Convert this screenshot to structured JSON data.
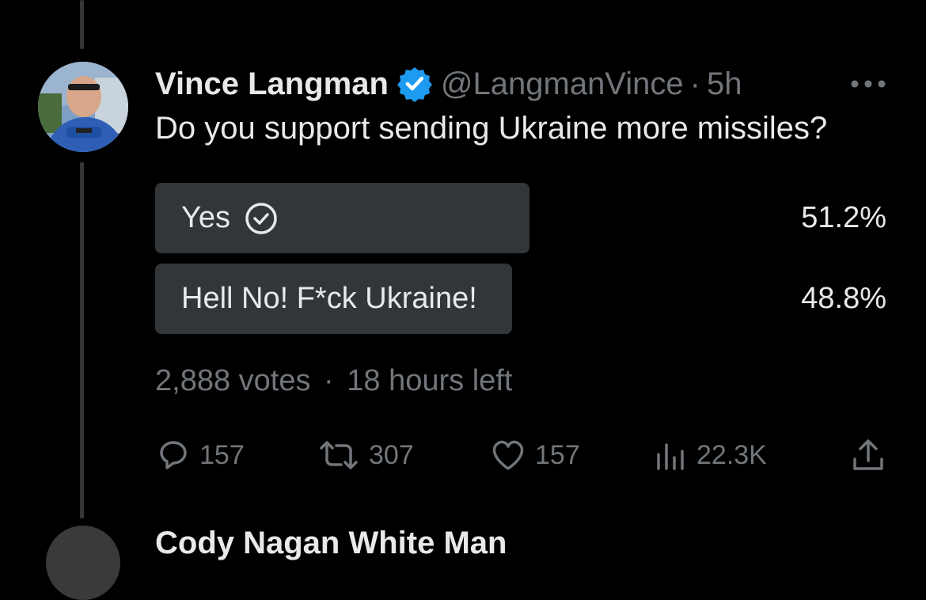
{
  "tweet": {
    "author_name": "Vince Langman",
    "handle": "@LangmanVince",
    "separator": "·",
    "time": "5h",
    "text": "Do you support sending Ukraine more missiles?",
    "verified_icon": "verified-badge-icon",
    "more_icon": "more-options-icon"
  },
  "poll": {
    "options": [
      {
        "label": "Yes",
        "percent": "51.2%",
        "fill": 0.512,
        "selected": true
      },
      {
        "label": "Hell No! F*ck Ukraine!",
        "percent": "48.8%",
        "fill": 0.488,
        "selected": false
      }
    ],
    "votes": "2,888 votes",
    "separator": "·",
    "time_left": "18 hours left"
  },
  "actions": {
    "replies": "157",
    "reposts": "307",
    "likes": "157",
    "views": "22.3K"
  },
  "colors": {
    "background": "#000000",
    "text": "#e7e9ea",
    "secondary": "#71767b",
    "poll_bar": "#333639",
    "verified": "#1d9bf0",
    "like_pink": "#f91880"
  },
  "next_tweet": {
    "author_name": "Cody Nagan White Man"
  }
}
